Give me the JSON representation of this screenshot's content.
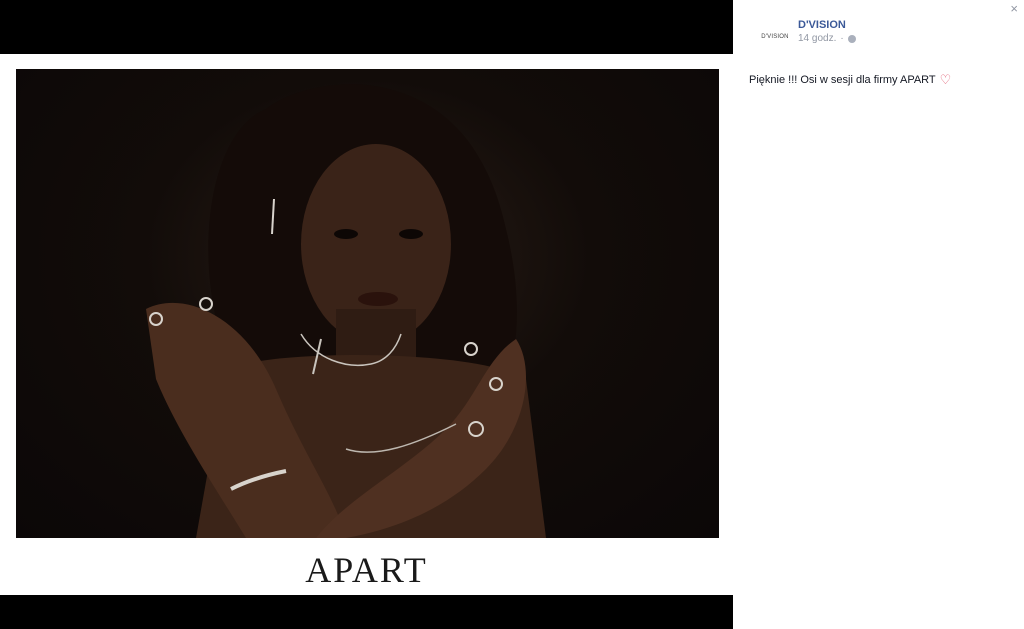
{
  "post": {
    "page_name": "D'VISION",
    "avatar_text": "D'VISION",
    "time": "14 godz.",
    "separator": "·",
    "text": "Pięknie !!! Osi w sesji dla firmy APART",
    "emoji": "♡"
  },
  "photo": {
    "brand": "APART"
  },
  "controls": {
    "close": "×"
  },
  "icons": {
    "globe": "globe-icon",
    "heart": "heart-icon",
    "close": "close-icon"
  },
  "colors": {
    "link": "#3b5998",
    "meta": "#9197a3",
    "text": "#141823"
  }
}
